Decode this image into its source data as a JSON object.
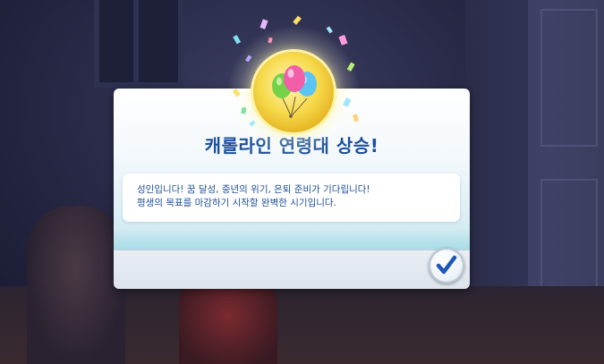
{
  "dialog": {
    "title": "캐롤라인 연령대 상승!",
    "message_line1": "성인입니다! 꿈 달성, 중년의 위기, 은퇴 준비가 기다립니다!",
    "message_line2": "평생의 목표를 마감하기 시작할 완벽한 시기입니다."
  },
  "icons": {
    "medallion": "balloons-icon",
    "confirm": "checkmark-icon"
  },
  "colors": {
    "title": "#1c4f9c",
    "message_text": "#1e4f96",
    "medallion_gold": "#f6d94a",
    "checkmark": "#1f57b8"
  }
}
